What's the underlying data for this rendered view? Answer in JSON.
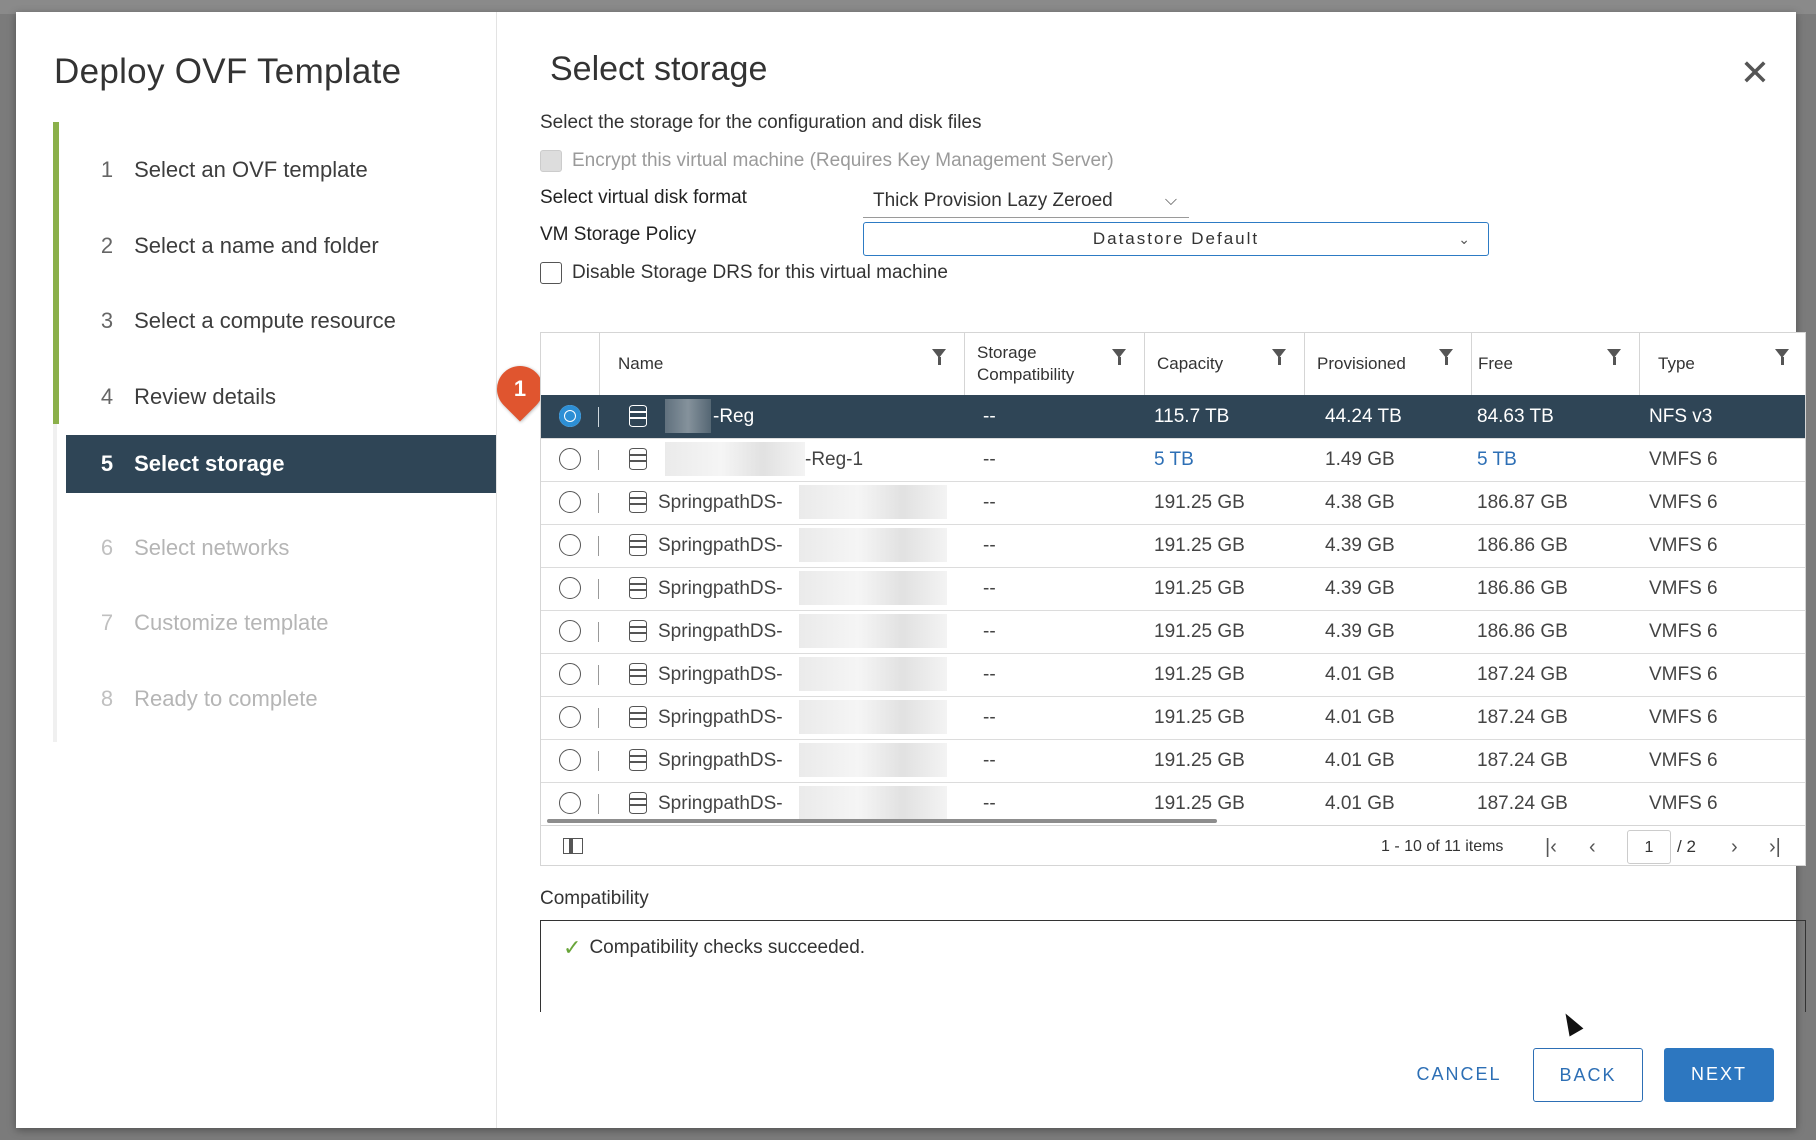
{
  "wizard": {
    "title": "Deploy OVF Template",
    "steps": [
      {
        "num": "1",
        "label": "Select an OVF template"
      },
      {
        "num": "2",
        "label": "Select a name and folder"
      },
      {
        "num": "3",
        "label": "Select a compute resource"
      },
      {
        "num": "4",
        "label": "Review details"
      },
      {
        "num": "5",
        "label": "Select storage"
      },
      {
        "num": "6",
        "label": "Select networks"
      },
      {
        "num": "7",
        "label": "Customize template"
      },
      {
        "num": "8",
        "label": "Ready to complete"
      }
    ],
    "active_step": 5
  },
  "badge": "1",
  "page": {
    "title": "Select storage",
    "description": "Select the storage for the configuration and disk files",
    "encrypt_label": "Encrypt this virtual machine (Requires Key Management Server)",
    "disk_format_label": "Select virtual disk format",
    "disk_format_value": "Thick Provision Lazy Zeroed",
    "policy_label": "VM Storage Policy",
    "policy_value": "Datastore Default",
    "drs_label": "Disable Storage DRS for this virtual machine"
  },
  "grid": {
    "columns": [
      "Name",
      "Storage Compatibility",
      "Capacity",
      "Provisioned",
      "Free",
      "Type"
    ],
    "rows": [
      {
        "name": "-Reg",
        "compat": "--",
        "capacity": "115.7 TB",
        "provisioned": "44.24 TB",
        "free": "84.63 TB",
        "type": "NFS v3",
        "selected": true
      },
      {
        "name": "-Reg-1",
        "compat": "--",
        "capacity": "5 TB",
        "provisioned": "1.49 GB",
        "free": "5 TB",
        "type": "VMFS 6",
        "selected": false
      },
      {
        "name": "SpringpathDS-",
        "compat": "--",
        "capacity": "191.25 GB",
        "provisioned": "4.38 GB",
        "free": "186.87 GB",
        "type": "VMFS 6",
        "selected": false
      },
      {
        "name": "SpringpathDS-",
        "compat": "--",
        "capacity": "191.25 GB",
        "provisioned": "4.39 GB",
        "free": "186.86 GB",
        "type": "VMFS 6",
        "selected": false
      },
      {
        "name": "SpringpathDS-",
        "compat": "--",
        "capacity": "191.25 GB",
        "provisioned": "4.39 GB",
        "free": "186.86 GB",
        "type": "VMFS 6",
        "selected": false
      },
      {
        "name": "SpringpathDS-",
        "compat": "--",
        "capacity": "191.25 GB",
        "provisioned": "4.39 GB",
        "free": "186.86 GB",
        "type": "VMFS 6",
        "selected": false
      },
      {
        "name": "SpringpathDS-",
        "compat": "--",
        "capacity": "191.25 GB",
        "provisioned": "4.01 GB",
        "free": "187.24 GB",
        "type": "VMFS 6",
        "selected": false
      },
      {
        "name": "SpringpathDS-",
        "compat": "--",
        "capacity": "191.25 GB",
        "provisioned": "4.01 GB",
        "free": "187.24 GB",
        "type": "VMFS 6",
        "selected": false
      },
      {
        "name": "SpringpathDS-",
        "compat": "--",
        "capacity": "191.25 GB",
        "provisioned": "4.01 GB",
        "free": "187.24 GB",
        "type": "VMFS 6",
        "selected": false
      },
      {
        "name": "SpringpathDS-",
        "compat": "--",
        "capacity": "191.25 GB",
        "provisioned": "4.01 GB",
        "free": "187.24 GB",
        "type": "VMFS 6",
        "selected": false
      }
    ],
    "pager_text": "1 - 10 of 11 items",
    "page_current": "1",
    "page_total": "/ 2"
  },
  "compatibility": {
    "label": "Compatibility",
    "message": "Compatibility checks succeeded."
  },
  "buttons": {
    "cancel": "CANCEL",
    "back": "BACK",
    "next": "NEXT"
  },
  "colors": {
    "nav_active": "#2f4556",
    "accent": "#2d77c0",
    "progress": "#8bb04a",
    "badge": "#e0552f"
  }
}
